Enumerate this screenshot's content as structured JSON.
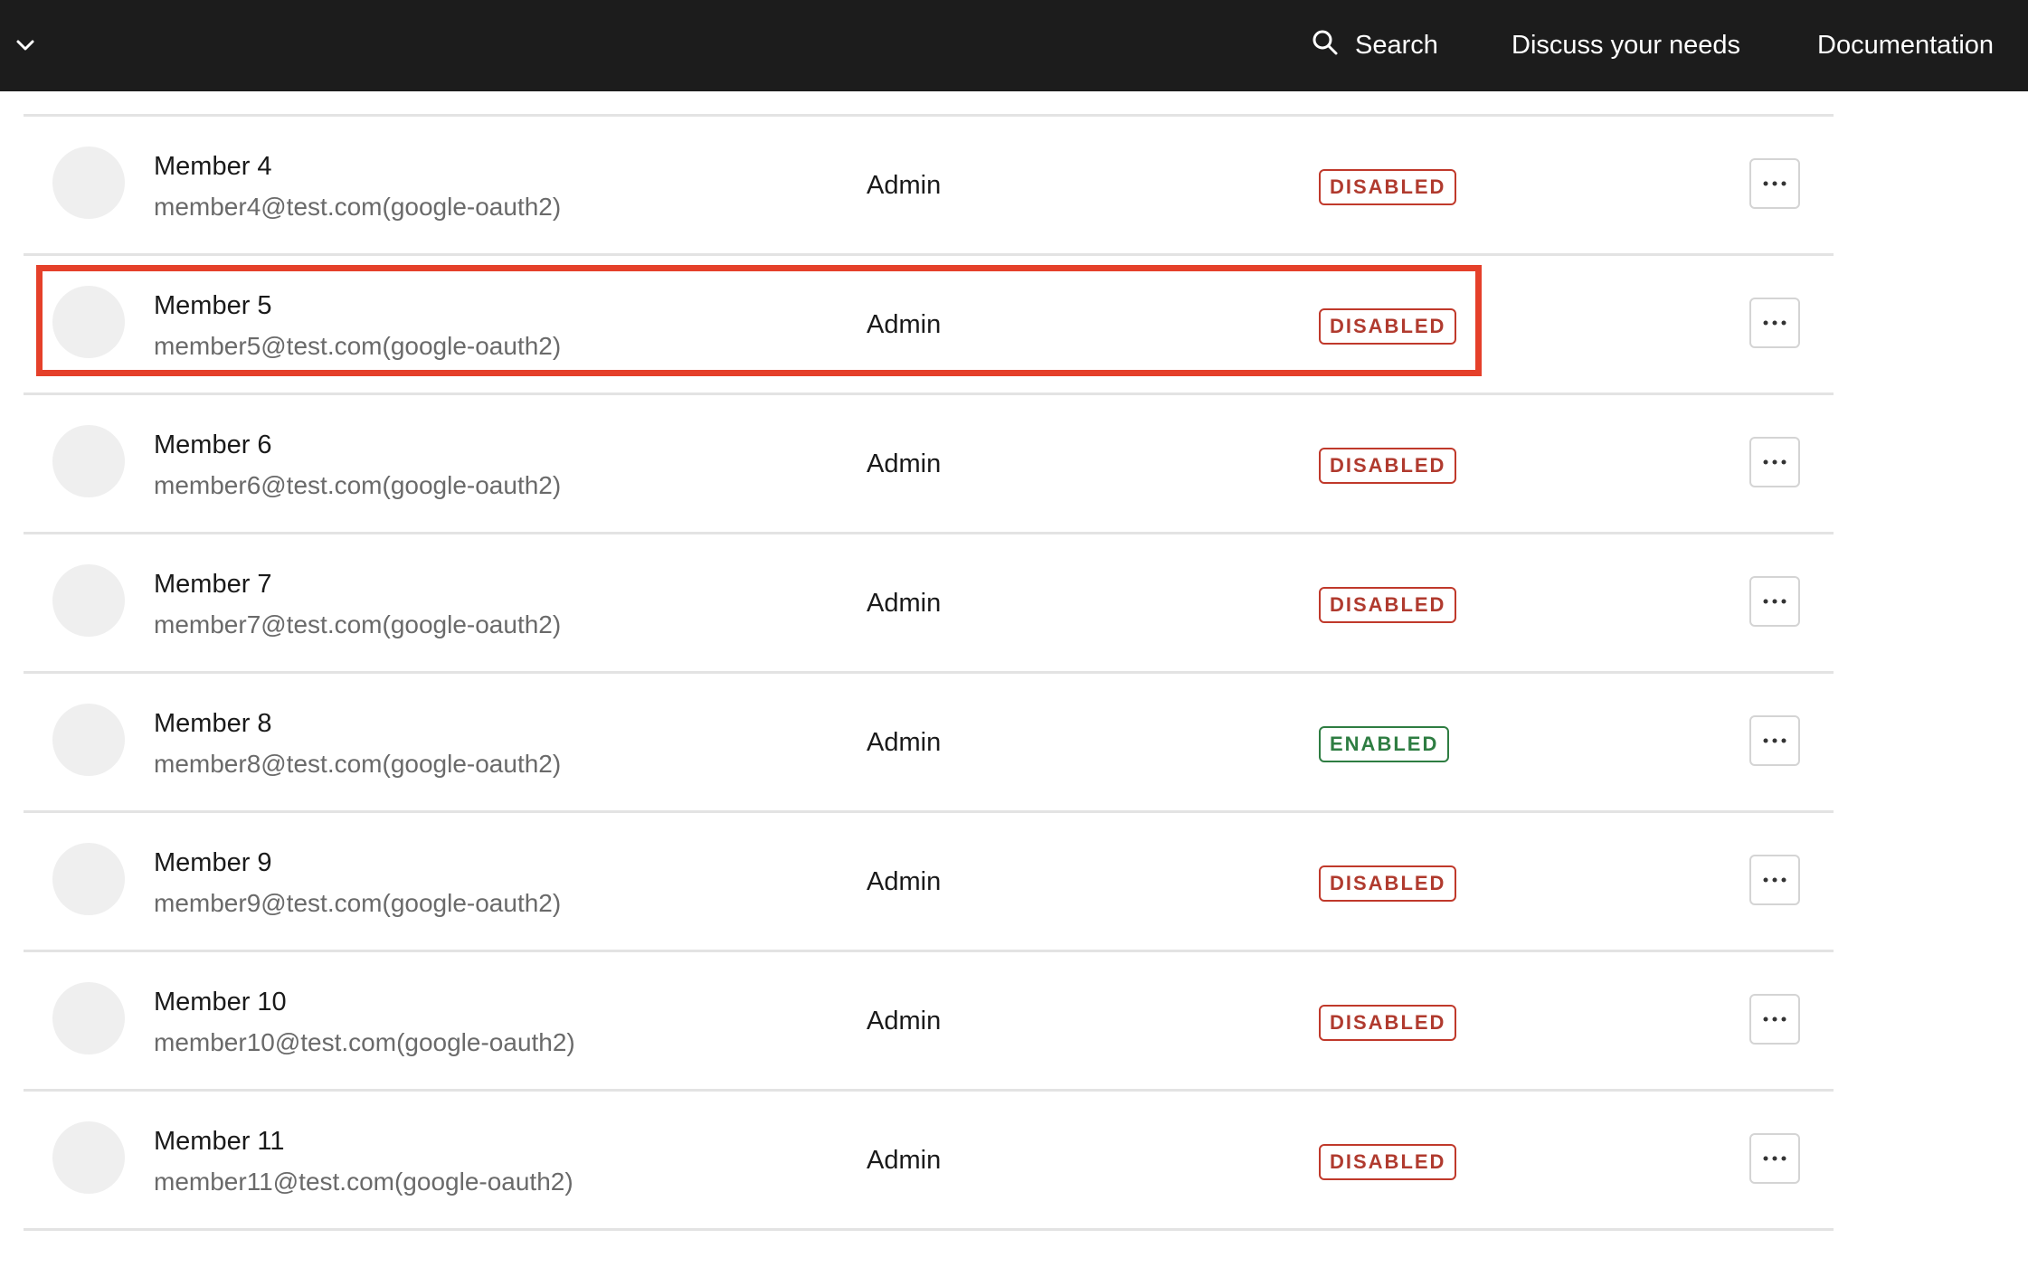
{
  "header": {
    "search_label": "Search",
    "discuss_label": "Discuss your needs",
    "docs_label": "Documentation",
    "icons": {
      "menu": "chevron-down-icon",
      "search": "search-icon"
    }
  },
  "members": [
    {
      "name": "Member 4",
      "email": "member4@test.com(google-oauth2)",
      "role": "Admin",
      "status": "DISABLED"
    },
    {
      "name": "Member 5",
      "email": "member5@test.com(google-oauth2)",
      "role": "Admin",
      "status": "DISABLED"
    },
    {
      "name": "Member 6",
      "email": "member6@test.com(google-oauth2)",
      "role": "Admin",
      "status": "DISABLED"
    },
    {
      "name": "Member 7",
      "email": "member7@test.com(google-oauth2)",
      "role": "Admin",
      "status": "DISABLED"
    },
    {
      "name": "Member 8",
      "email": "member8@test.com(google-oauth2)",
      "role": "Admin",
      "status": "ENABLED"
    },
    {
      "name": "Member 9",
      "email": "member9@test.com(google-oauth2)",
      "role": "Admin",
      "status": "DISABLED"
    },
    {
      "name": "Member 10",
      "email": "member10@test.com(google-oauth2)",
      "role": "Admin",
      "status": "DISABLED"
    },
    {
      "name": "Member 11",
      "email": "member11@test.com(google-oauth2)",
      "role": "Admin",
      "status": "DISABLED"
    }
  ],
  "colors": {
    "header_bg": "#1c1c1c",
    "disabled": "#b03a2e",
    "enabled": "#2e7d42",
    "highlight": "#e5402a"
  },
  "highlighted_row": "Member 5"
}
